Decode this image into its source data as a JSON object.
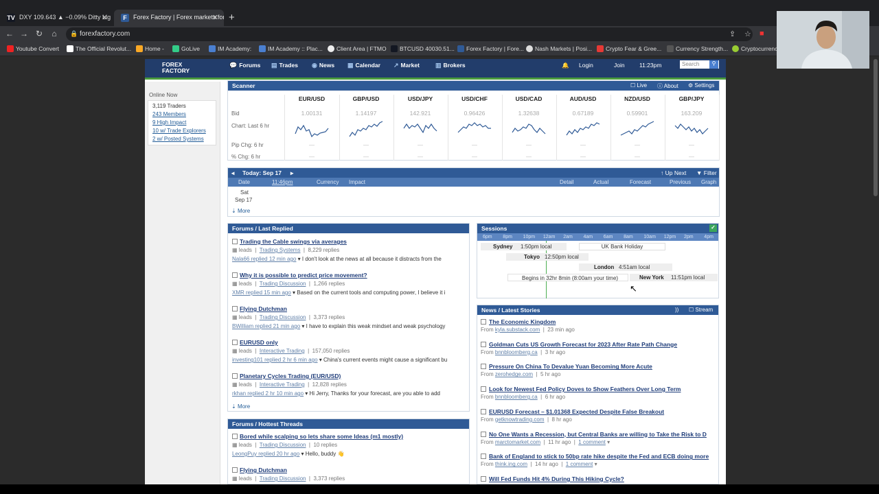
{
  "browser": {
    "tabs": [
      {
        "title": "DXY 109.643 ▲ −0.09% Ditty Lig",
        "icon": "tradingview-icon"
      },
      {
        "title": "Forex Factory | Forex markets for",
        "icon": "forexfactory-icon"
      }
    ],
    "url": "forexfactory.com",
    "bookmarks": [
      "Youtube Convert",
      "The Official Revolut...",
      "Home -",
      "GoLive",
      "IM Academy:",
      "IM Academy :: Plac...",
      "Client Area | FTMO",
      "BTCUSD 40030.51...",
      "Forex Factory | Fore...",
      "Nash Markets | Posi...",
      "Crypto Fear & Gree...",
      "Currency Strength...",
      "Cryptocurrenc"
    ]
  },
  "site": {
    "logo_line1": "FOREX",
    "logo_line2": "FACTORY",
    "nav": [
      "Forums",
      "Trades",
      "News",
      "Calendar",
      "Market",
      "Brokers"
    ],
    "login": "Login",
    "join": "Join",
    "time": "11:23pm",
    "search_placeholder": "Search"
  },
  "online": {
    "title": "Online Now",
    "items": [
      "3,119 Traders",
      "243 Members",
      "9 High Impact",
      "10 w/ Trade Explorers",
      "2 w/ Posted Systems"
    ]
  },
  "scanner": {
    "title": "Scanner",
    "live": "Live",
    "about": "About",
    "settings": "Settings",
    "row_bid": "Bid",
    "row_chart": "Chart: Last 6 hr",
    "row_pip": "Pip Chg: 6 hr",
    "row_pct": "% Chg: 6 hr",
    "dash": "—",
    "pairs": [
      {
        "name": "EUR/USD",
        "bid": "1.00131"
      },
      {
        "name": "GBP/USD",
        "bid": "1.14197"
      },
      {
        "name": "USD/JPY",
        "bid": "142.921"
      },
      {
        "name": "USD/CHF",
        "bid": "0.96426"
      },
      {
        "name": "USD/CAD",
        "bid": "1.32638"
      },
      {
        "name": "AUD/USD",
        "bid": "0.67189"
      },
      {
        "name": "NZD/USD",
        "bid": "0.59901"
      },
      {
        "name": "GBP/JPY",
        "bid": "163.209"
      }
    ]
  },
  "calendar": {
    "title": "Today: Sep 17",
    "up_next": "Up Next",
    "filter": "Filter",
    "cols": {
      "date": "Date",
      "time": "11:46pm",
      "currency": "Currency",
      "impact": "Impact",
      "detail": "Detail",
      "actual": "Actual",
      "forecast": "Forecast",
      "previous": "Previous",
      "graph": "Graph"
    },
    "day": "Sat",
    "date": "Sep 17",
    "more": "More"
  },
  "forum": {
    "title": "Forums / Last Replied",
    "threads": [
      {
        "title": "Trading the Cable swings via averages",
        "by": "leads",
        "sub": "Trading Systems",
        "replies": "8,229 replies",
        "who": "Nala66 replied 12 min ago",
        "text": "I don't look at the news at all because it distracts from the"
      },
      {
        "title": "Why it is possible to predict price movement?",
        "by": "leads",
        "sub": "Trading Discussion",
        "replies": "1,266 replies",
        "who": "XMR replied 15 min ago",
        "text": "Based on the current tools and computing power, I believe it i"
      },
      {
        "title": "Flying Dutchman",
        "by": "leads",
        "sub": "Trading Discussion",
        "replies": "3,373 replies",
        "who": "BWilliam replied 21 min ago",
        "text": "I have to explain this weak mindset and weak psychology"
      },
      {
        "title": "EURUSD only",
        "by": "leads",
        "sub": "Interactive Trading",
        "replies": "157,050 replies",
        "who": "investing101 replied 2 hr 6 min ago",
        "text": "China's current events might cause a significant bu"
      },
      {
        "title": "Planetary Cycles Trading (EUR/USD)",
        "by": "leads",
        "sub": "Interactive Trading",
        "replies": "12,828 replies",
        "who": "rkhan replied 2 hr 10 min ago",
        "text": "Hi Jerry, Thanks for your forecast, are you able to add"
      }
    ],
    "more": "More"
  },
  "hottest": {
    "title": "Forums / Hottest Threads",
    "threads": [
      {
        "title": "Bored while scalping so lets share some Ideas (m1 mostly)",
        "by": "leads",
        "sub": "Trading Discussion",
        "replies": "10 replies",
        "who": "LeongPuy replied 20 hr ago",
        "text": "Hello, buddy 👋"
      },
      {
        "title": "Flying Dutchman",
        "by": "leads",
        "sub": "Trading Discussion",
        "replies": "3,373 replies"
      }
    ]
  },
  "sessions": {
    "title": "Sessions",
    "scale": [
      "6pm",
      "8pm",
      "10pm",
      "12am",
      "2am",
      "4am",
      "6am",
      "8am",
      "10am",
      "12pm",
      "2pm",
      "4pm"
    ],
    "sydney": "Sydney",
    "sydney_time": "1:50pm local",
    "holiday": "UK Bank Holiday",
    "tokyo": "Tokyo",
    "tokyo_time": "12:50pm local",
    "london": "London",
    "london_time": "4:51am local",
    "begins": "Begins in 32hr 8min (8:00am your time)",
    "newyork": "New York",
    "newyork_time": "11:51pm local"
  },
  "news": {
    "title": "News / Latest Stories",
    "stream": "Stream",
    "stories": [
      {
        "title": "The Economic Kingdom",
        "src": "kyla.substack.com",
        "ago": "23 min ago",
        "comment": ""
      },
      {
        "title": "Goldman Cuts US Growth Forecast for 2023 After Rate Path Change",
        "src": "bnnbloomberg.ca",
        "ago": "3 hr ago",
        "comment": ""
      },
      {
        "title": "Pressure On China To Devalue Yuan Becoming More Acute",
        "src": "zerohedge.com",
        "ago": "5 hr ago",
        "comment": ""
      },
      {
        "title": "Look for Newest Fed Policy Doves to Show Feathers Over Long Term",
        "src": "bnnbloomberg.ca",
        "ago": "6 hr ago",
        "comment": ""
      },
      {
        "title": "EURUSD Forecast – $1.01368 Expected Despite False Breakout",
        "src": "getknowtrading.com",
        "ago": "8 hr ago",
        "comment": ""
      },
      {
        "title": "No One Wants a Recession, but Central Banks are willing to Take the Risk to D",
        "src": "marctomarket.com",
        "ago": "11 hr ago",
        "comment": "1 comment"
      },
      {
        "title": "Bank of England to stick to 50bp rate hike despite the Fed and ECB doing more",
        "src": "think.ing.com",
        "ago": "14 hr ago",
        "comment": "1 comment"
      },
      {
        "title": "Will Fed Funds Hit 4% During This Hiking Cycle?",
        "src": "",
        "ago": "",
        "comment": ""
      }
    ],
    "from": "From"
  }
}
